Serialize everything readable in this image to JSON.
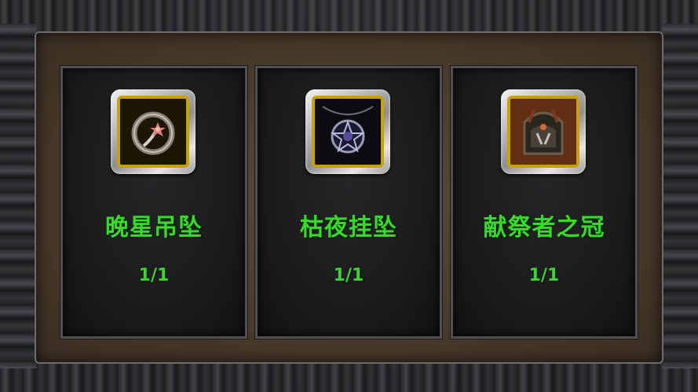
{
  "colors": {
    "text_green": "#38d92a",
    "gold_border": "#c9a008",
    "panel_brown": "#4a3b2b",
    "slot_dark": "#19191b"
  },
  "items": [
    {
      "name": "晚星吊坠",
      "count": "1/1",
      "icon": "star-pendant-icon"
    },
    {
      "name": "枯夜挂坠",
      "count": "1/1",
      "icon": "pentagram-necklace-icon"
    },
    {
      "name": "献祭者之冠",
      "count": "1/1",
      "icon": "sacrifice-crown-icon"
    }
  ]
}
